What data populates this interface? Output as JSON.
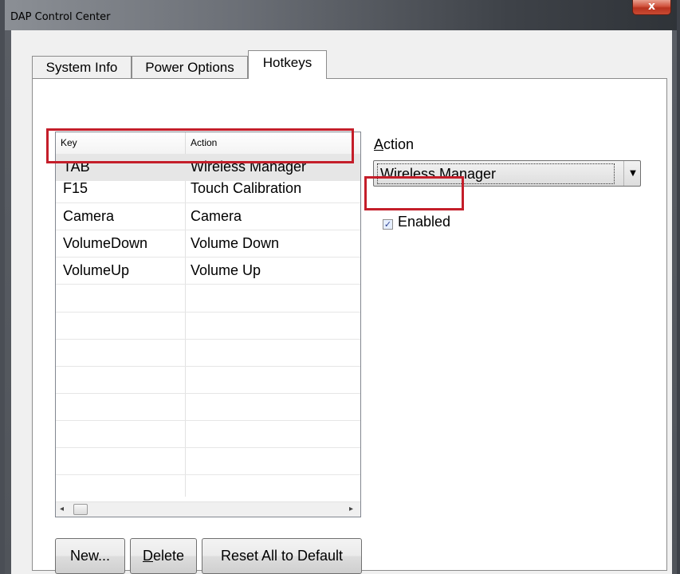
{
  "window": {
    "title": "DAP Control Center",
    "close_glyph": "x"
  },
  "tabs": [
    {
      "label": "System Info"
    },
    {
      "label": "Power Options"
    },
    {
      "label": "Hotkeys"
    }
  ],
  "hotkeys_list": {
    "columns": [
      "Key",
      "Action"
    ],
    "rows": [
      {
        "key": "TAB",
        "action": "Wireless Manager",
        "selected": true
      },
      {
        "key": "F15",
        "action": "Touch Calibration"
      },
      {
        "key": "Camera",
        "action": "Camera"
      },
      {
        "key": "VolumeDown",
        "action": "Volume Down"
      },
      {
        "key": "VolumeUp",
        "action": "Volume Up"
      }
    ],
    "scroll_left_glyph": "◂",
    "scroll_right_glyph": "▸"
  },
  "buttons": {
    "new": "New...",
    "delete": "Delete",
    "reset": "Reset All to Default"
  },
  "action_panel": {
    "label": "Action",
    "selected_action": "Wireless Manager",
    "dropdown_glyph": "▼",
    "enabled_label": "Enabled",
    "enabled_checked": true,
    "check_glyph": "✓"
  },
  "colors": {
    "highlight_box": "#c41e2a",
    "selected_row": "#e6e6e6"
  }
}
